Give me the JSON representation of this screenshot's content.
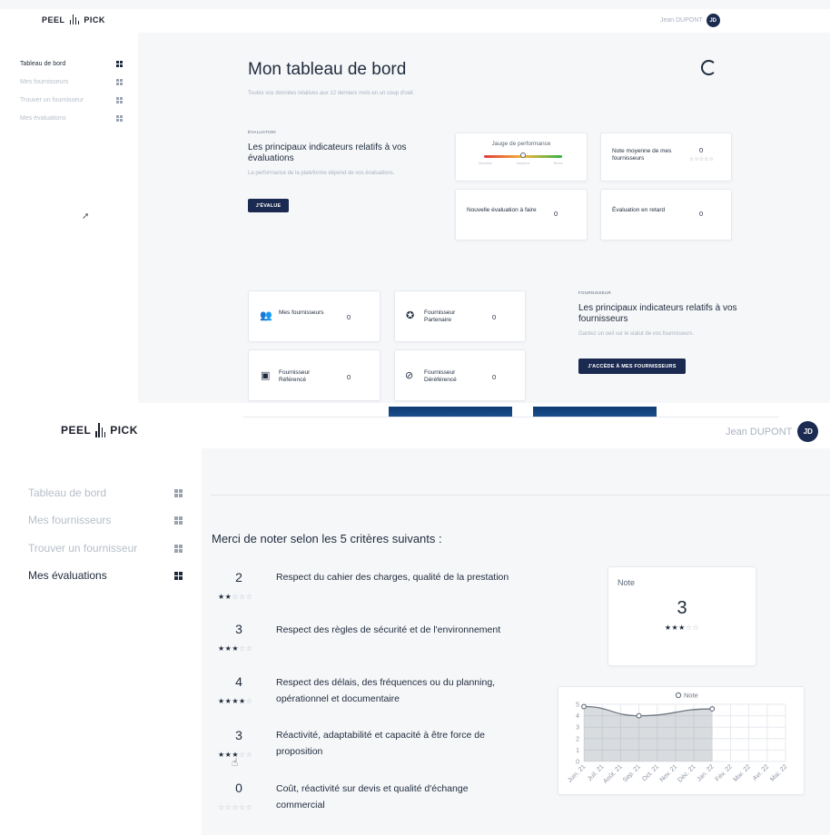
{
  "brand": {
    "left": "PEEL",
    "right": "PICK"
  },
  "user": {
    "name": "Jean DUPONT",
    "initials": "JD"
  },
  "nav": [
    {
      "label": "Tableau de bord"
    },
    {
      "label": "Mes fournisseurs"
    },
    {
      "label": "Trouver un fournisseur"
    },
    {
      "label": "Mes évaluations"
    }
  ],
  "dashboard": {
    "title": "Mon tableau de bord",
    "subtitle": "Toutes vos données relatives aux 12 derniers mois en un coup d'oeil.",
    "evaluation": {
      "eyebrow": "ÉVALUATION",
      "heading": "Les principaux indicateurs relatifs à vos évaluations",
      "text": "La performance de la plateforme dépend de vos évaluations.",
      "button": "J'ÉVALUE"
    },
    "gauge": {
      "title": "Jauge de performance",
      "scale": [
        "Mauvaise",
        "Moyenne",
        "Bonne"
      ],
      "level": 0.5
    },
    "kpis": {
      "note_moyenne": {
        "label": "Note moyenne de mes fournisseurs",
        "value": "0",
        "stars": "☆☆☆☆☆"
      },
      "nouvelle": {
        "label": "Nouvelle évaluation à faire",
        "value": "0"
      },
      "retard": {
        "label": "Évaluation en retard",
        "value": "0"
      }
    },
    "suppliers": {
      "eyebrow": "FOURNISSEUR",
      "heading": "Les principaux indicateurs relatifs à vos fournisseurs",
      "text": "Gardez un oeil sur le statut de vos fournisseurs.",
      "button": "J'ACCÈDE À MES FOURNISSEURS",
      "cards": [
        {
          "label": "Mes fournisseurs",
          "value": "0",
          "icon": "users-icon"
        },
        {
          "label": "Fournisseur Partenaire",
          "value": "0",
          "icon": "badge-icon"
        },
        {
          "label": "Fournisseur Référencé",
          "value": "0",
          "icon": "document-check-icon"
        },
        {
          "label": "Fournisseur Déréférencé",
          "value": "0",
          "icon": "users-off-icon"
        }
      ]
    }
  },
  "evaluation_page": {
    "title": "Merci de noter selon les 5 critères suivants :",
    "criteria": [
      {
        "score": "2",
        "filled": "★★",
        "empty": "☆☆☆",
        "text": "Respect du cahier des charges, qualité de la prestation"
      },
      {
        "score": "3",
        "filled": "★★★",
        "empty": "☆☆",
        "text": "Respect des règles de sécurité et de l'environnement"
      },
      {
        "score": "4",
        "filled": "★★★★",
        "empty": "☆",
        "text": "Respect des délais, des fréquences ou du planning, opérationnel et documentaire"
      },
      {
        "score": "3",
        "filled": "★★★",
        "empty": "☆☆",
        "text": "Réactivité, adaptabilité et capacité à être force de proposition"
      },
      {
        "score": "0",
        "filled": "",
        "empty": "☆☆☆☆☆",
        "text": "Coût, réactivité sur devis et qualité d'échange commercial"
      }
    ],
    "note": {
      "label": "Note",
      "value": "3",
      "filled": "★★★",
      "empty": "☆☆"
    }
  },
  "chart_data": {
    "type": "area",
    "series": [
      {
        "name": "Note",
        "color": "#6f7784",
        "points": [
          {
            "x": "Juin. 21",
            "y": 4.8
          },
          {
            "x": "Sep. 21",
            "y": 4.0
          },
          {
            "x": "Jan. 22",
            "y": 4.6
          }
        ]
      }
    ],
    "categories": [
      "Juin. 21",
      "Juil. 21",
      "Août. 21",
      "Sep. 21",
      "Oct. 21",
      "Nov. 21",
      "Déc. 21",
      "Jan. 22",
      "Fév. 22",
      "Mar. 22",
      "Avr. 22",
      "Mai. 22"
    ],
    "yticks": [
      "0",
      "1",
      "2",
      "3",
      "4",
      "5"
    ],
    "ylim": [
      0,
      5
    ],
    "legend_position": "top",
    "grid": true
  },
  "colors": {
    "primary": "#1b2a50",
    "accent_bar": "#0e3b73",
    "text": "#1f2b3d",
    "muted": "#a9b2c0"
  }
}
